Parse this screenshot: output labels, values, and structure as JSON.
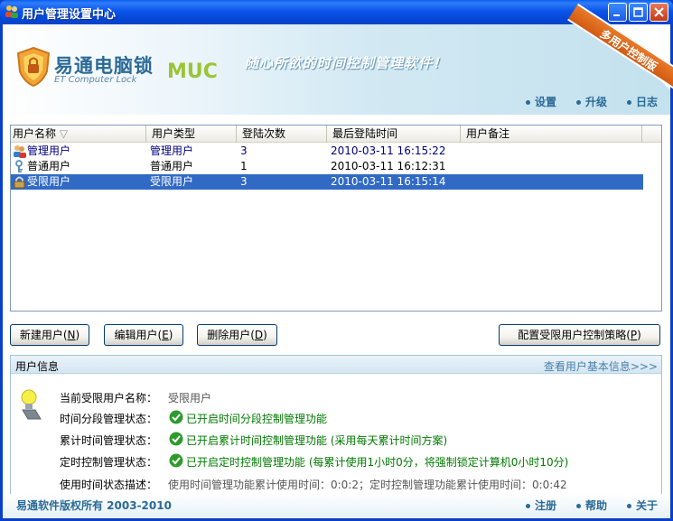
{
  "window": {
    "title": "用户管理设置中心"
  },
  "banner": {
    "brand": "易通电脑锁",
    "brand_en": "ET Computer Lock",
    "muc": "MUC",
    "slogan": "随心所欲的时间控制管理软件！",
    "ribbon": "多用户控制版",
    "links": [
      "设置",
      "升级",
      "日志"
    ]
  },
  "list": {
    "columns": [
      "用户名称",
      "用户类型",
      "登陆次数",
      "最后登陆时间",
      "用户备注"
    ],
    "rows": [
      {
        "name": "管理用户",
        "type": "管理用户",
        "count": "3",
        "last": "2010-03-11 16:15:22",
        "note": ""
      },
      {
        "name": "普通用户",
        "type": "普通用户",
        "count": "1",
        "last": "2010-03-11 16:12:31",
        "note": ""
      },
      {
        "name": "受限用户",
        "type": "受限用户",
        "count": "3",
        "last": "2010-03-11 16:15:14",
        "note": ""
      }
    ],
    "selected_row": 2
  },
  "buttons": {
    "new_user": "新建用户(",
    "new_user_key": "N",
    "edit_user": "编辑用户(",
    "edit_user_key": "E",
    "delete_user": "删除用户(",
    "delete_user_key": "D",
    "policy": "配置受限用户控制策略(",
    "policy_key": "P",
    "close_paren": ")"
  },
  "info": {
    "title": "用户信息",
    "link": "查看用户基本信息>>>",
    "rows": [
      {
        "label": "当前受限用户名称：",
        "value": "受限用户"
      },
      {
        "label": "时间分段管理状态：",
        "value": "已开启时间分段控制管理功能"
      },
      {
        "label": "累计时间管理状态：",
        "value": "已开启累计时间控制管理功能 (采用每天累计时间方案)"
      },
      {
        "label": "定时控制管理状态：",
        "value": "已开启定时控制管理功能 (每累计使用1小时0分，将强制锁定计算机0小时10分)"
      },
      {
        "label": "使用时间状态描述：",
        "value": "使用时间管理功能累计使用时间：0:0:2；定时控制管理功能累计使用时间：0:0:42"
      }
    ]
  },
  "footer": {
    "copyright": "易通软件版权所有 2003-2010",
    "links": [
      "注册",
      "帮助",
      "关于"
    ]
  }
}
